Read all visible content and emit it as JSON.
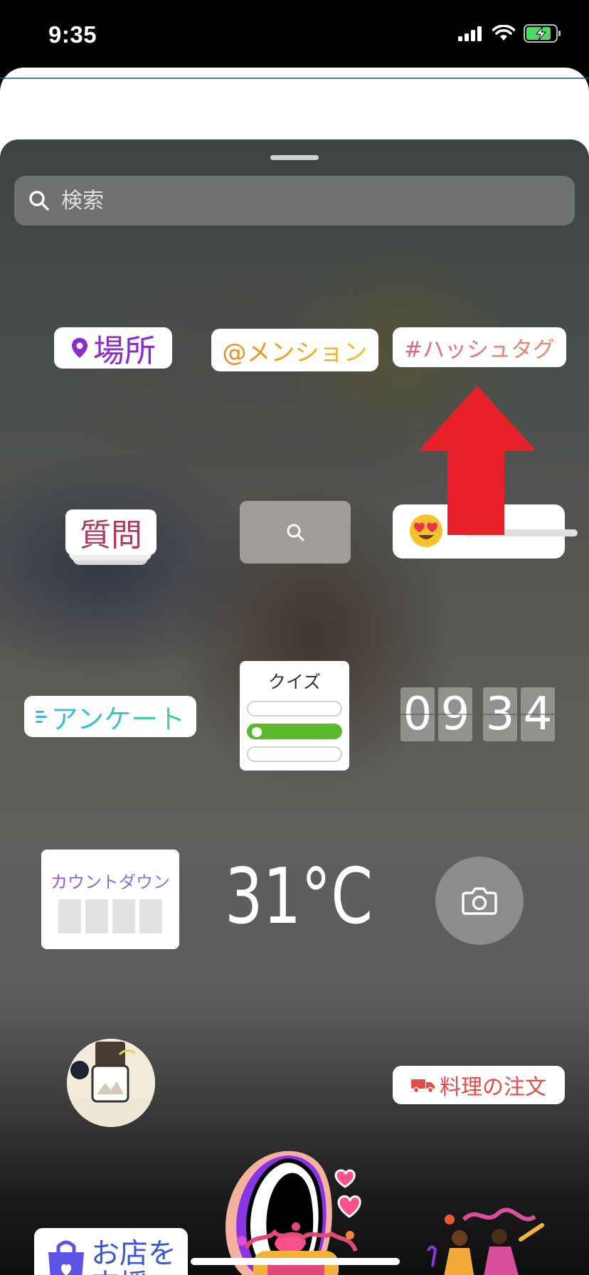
{
  "status_bar": {
    "time": "9:35"
  },
  "search": {
    "placeholder": "検索"
  },
  "stickers": {
    "location": "場所",
    "mention": "@メンション",
    "hashtag": "#ハッシュタグ",
    "question": "質問",
    "poll": "アンケート",
    "quiz": "クイズ",
    "time": [
      "0",
      "9",
      "3",
      "4"
    ],
    "countdown": "カウントダウン",
    "temperature": "31°C",
    "food_order": "料理の注文",
    "shop": [
      "お店を",
      "支援"
    ]
  },
  "annotation": {
    "arrow_color": "#e8202a"
  }
}
